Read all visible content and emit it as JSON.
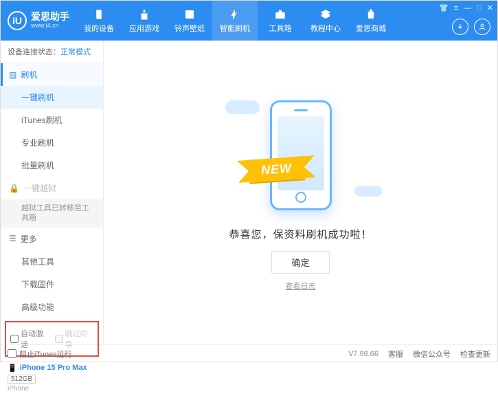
{
  "header": {
    "app_name": "爱思助手",
    "app_url": "www.i4.cn",
    "logo_letter": "iU",
    "nav": [
      {
        "label": "我的设备",
        "icon": "device"
      },
      {
        "label": "应用游戏",
        "icon": "apps"
      },
      {
        "label": "铃声壁纸",
        "icon": "wallpaper"
      },
      {
        "label": "智能刷机",
        "icon": "flash",
        "active": true
      },
      {
        "label": "工具箱",
        "icon": "toolbox"
      },
      {
        "label": "教程中心",
        "icon": "tutorial"
      },
      {
        "label": "爱思商城",
        "icon": "store"
      }
    ]
  },
  "sidebar": {
    "status_label": "设备连接状态：",
    "status_value": "正常模式",
    "group_flash": {
      "title": "刷机"
    },
    "subs_flash": [
      {
        "label": "一键刷机",
        "active": true
      },
      {
        "label": "iTunes刷机"
      },
      {
        "label": "专业刷机"
      },
      {
        "label": "批量刷机"
      }
    ],
    "group_jailbreak": {
      "title": "一键越狱",
      "locked": true
    },
    "jailbreak_note": "越狱工具已转移至工具箱",
    "group_more": {
      "title": "更多"
    },
    "subs_more": [
      {
        "label": "其他工具"
      },
      {
        "label": "下载固件"
      },
      {
        "label": "高级功能"
      }
    ],
    "checks": {
      "auto_activate": "自动激活",
      "skip_guide": "跳过向导"
    },
    "device": {
      "name": "iPhone 15 Pro Max",
      "storage": "512GB",
      "type": "iPhone"
    }
  },
  "main": {
    "ribbon": "NEW",
    "success": "恭喜您，保资料刷机成功啦！",
    "ok": "确定",
    "view_log": "查看日志"
  },
  "footer": {
    "block_itunes": "阻止iTunes运行",
    "version": "V7.98.66",
    "links": [
      "客服",
      "微信公众号",
      "检查更新"
    ]
  }
}
